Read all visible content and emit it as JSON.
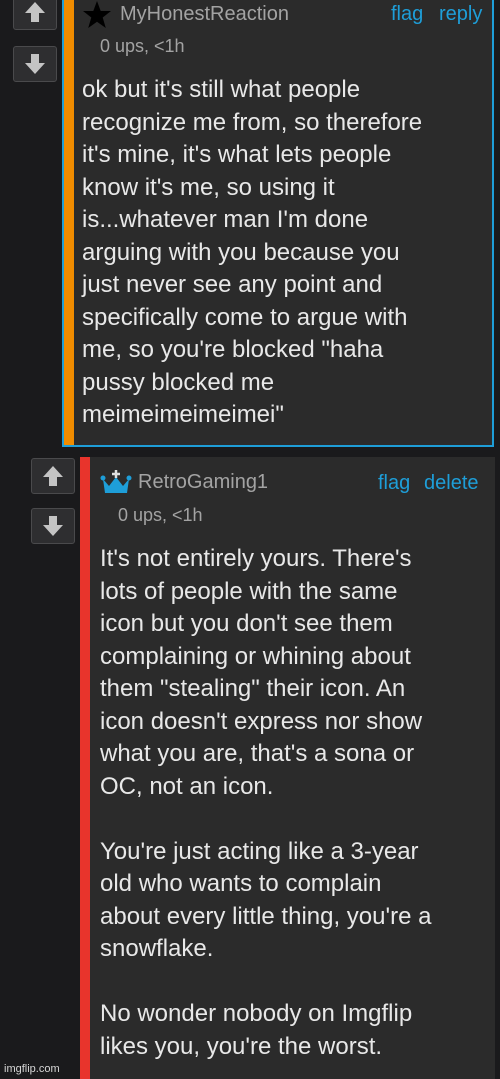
{
  "comments": [
    {
      "username": "MyHonestReaction",
      "meta": "0 ups, <1h",
      "actions": [
        "flag",
        "reply"
      ],
      "bar_color": "#f08c00",
      "icon": "star-icon",
      "body": "ok but it's still what people\nrecognize me from, so therefore\nit's mine, it's what lets people\nknow it's me, so using it\nis...whatever man I'm done\narguing with you because you\njust never see any point and\nspecifically come to argue with\nme, so you're blocked \"haha\npussy blocked me\nmeimeimeimeimei\""
    },
    {
      "username": "RetroGaming1",
      "meta": "0 ups, <1h",
      "actions": [
        "flag",
        "delete"
      ],
      "bar_color": "#e8342c",
      "icon": "crown-icon",
      "body": "It's not entirely yours. There's\nlots of people with the same\nicon but you don't see them\ncomplaining or whining about\nthem \"stealing\" their icon. An\nicon doesn't express nor show\nwhat you are, that's a sona or\nOC, not an icon.\n\nYou're just acting like a 3-year\nold who wants to complain\nabout every little thing, you're a\nsnowflake.\n\nNo wonder nobody on Imgflip\nlikes you, you're the worst."
    }
  ],
  "watermark": "imgflip.com",
  "colors": {
    "link": "#1e9ed8",
    "panel": "#2b2b2b",
    "border": "#1e9ed8"
  },
  "icons": {
    "upvote": "arrow-up-icon",
    "downvote": "arrow-down-icon"
  }
}
